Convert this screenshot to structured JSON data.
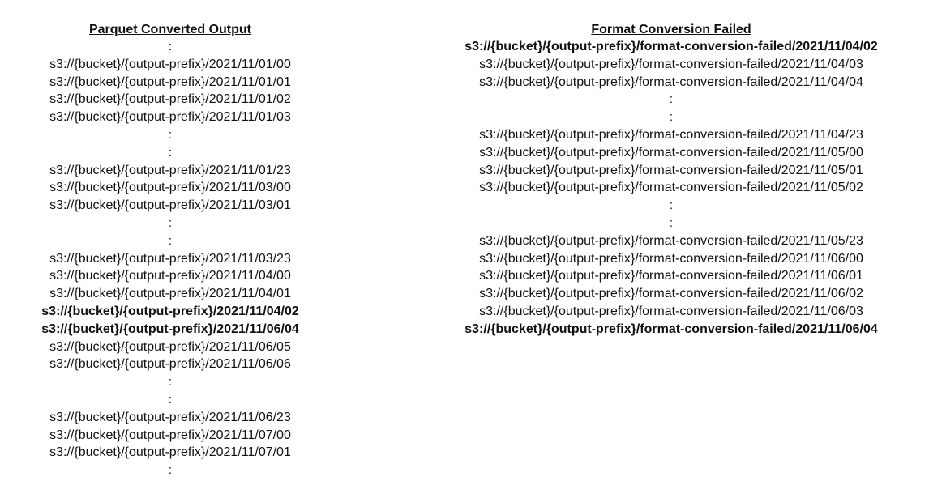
{
  "left_column": {
    "title": "Parquet Converted Output",
    "lines": [
      {
        "text": ":",
        "bold": false
      },
      {
        "text": "s3://{bucket}/{output-prefix}/2021/11/01/00",
        "bold": false
      },
      {
        "text": "s3://{bucket}/{output-prefix}/2021/11/01/01",
        "bold": false
      },
      {
        "text": "s3://{bucket}/{output-prefix}/2021/11/01/02",
        "bold": false
      },
      {
        "text": "s3://{bucket}/{output-prefix}/2021/11/01/03",
        "bold": false
      },
      {
        "text": ":",
        "bold": false
      },
      {
        "text": ":",
        "bold": false
      },
      {
        "text": "s3://{bucket}/{output-prefix}/2021/11/01/23",
        "bold": false
      },
      {
        "text": "s3://{bucket}/{output-prefix}/2021/11/03/00",
        "bold": false
      },
      {
        "text": "s3://{bucket}/{output-prefix}/2021/11/03/01",
        "bold": false
      },
      {
        "text": ":",
        "bold": false
      },
      {
        "text": ":",
        "bold": false
      },
      {
        "text": "s3://{bucket}/{output-prefix}/2021/11/03/23",
        "bold": false
      },
      {
        "text": "s3://{bucket}/{output-prefix}/2021/11/04/00",
        "bold": false
      },
      {
        "text": "s3://{bucket}/{output-prefix}/2021/11/04/01",
        "bold": false
      },
      {
        "text": "s3://{bucket}/{output-prefix}/2021/11/04/02",
        "bold": true
      },
      {
        "text": "s3://{bucket}/{output-prefix}/2021/11/06/04",
        "bold": true
      },
      {
        "text": "s3://{bucket}/{output-prefix}/2021/11/06/05",
        "bold": false
      },
      {
        "text": "s3://{bucket}/{output-prefix}/2021/11/06/06",
        "bold": false
      },
      {
        "text": ":",
        "bold": false
      },
      {
        "text": ":",
        "bold": false
      },
      {
        "text": "s3://{bucket}/{output-prefix}/2021/11/06/23",
        "bold": false
      },
      {
        "text": "s3://{bucket}/{output-prefix}/2021/11/07/00",
        "bold": false
      },
      {
        "text": "s3://{bucket}/{output-prefix}/2021/11/07/01",
        "bold": false
      },
      {
        "text": ":",
        "bold": false
      }
    ]
  },
  "right_column": {
    "title": "Format Conversion Failed",
    "lines": [
      {
        "text": "s3://{bucket}/{output-prefix}/format-conversion-failed/2021/11/04/02",
        "bold": true
      },
      {
        "text": "s3://{bucket}/{output-prefix}/format-conversion-failed/2021/11/04/03",
        "bold": false
      },
      {
        "text": "s3://{bucket}/{output-prefix}/format-conversion-failed/2021/11/04/04",
        "bold": false
      },
      {
        "text": ":",
        "bold": false
      },
      {
        "text": ":",
        "bold": false
      },
      {
        "text": "s3://{bucket}/{output-prefix}/format-conversion-failed/2021/11/04/23",
        "bold": false
      },
      {
        "text": "s3://{bucket}/{output-prefix}/format-conversion-failed/2021/11/05/00",
        "bold": false
      },
      {
        "text": "s3://{bucket}/{output-prefix}/format-conversion-failed/2021/11/05/01",
        "bold": false
      },
      {
        "text": "s3://{bucket}/{output-prefix}/format-conversion-failed/2021/11/05/02",
        "bold": false
      },
      {
        "text": ":",
        "bold": false
      },
      {
        "text": ":",
        "bold": false
      },
      {
        "text": "s3://{bucket}/{output-prefix}/format-conversion-failed/2021/11/05/23",
        "bold": false
      },
      {
        "text": "s3://{bucket}/{output-prefix}/format-conversion-failed/2021/11/06/00",
        "bold": false
      },
      {
        "text": "s3://{bucket}/{output-prefix}/format-conversion-failed/2021/11/06/01",
        "bold": false
      },
      {
        "text": "s3://{bucket}/{output-prefix}/format-conversion-failed/2021/11/06/02",
        "bold": false
      },
      {
        "text": "s3://{bucket}/{output-prefix}/format-conversion-failed/2021/11/06/03",
        "bold": false
      },
      {
        "text": "s3://{bucket}/{output-prefix}/format-conversion-failed/2021/11/06/04",
        "bold": true
      }
    ]
  }
}
